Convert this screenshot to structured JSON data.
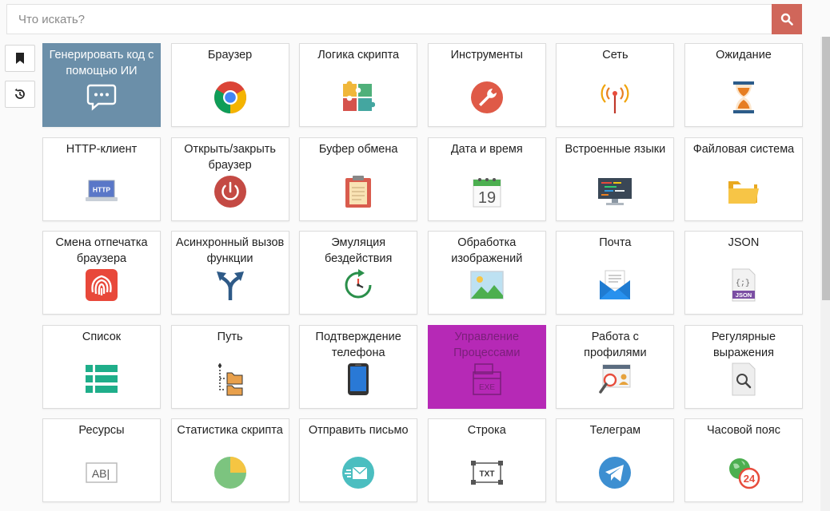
{
  "search": {
    "placeholder": "Что искать?"
  },
  "tiles": [
    {
      "label": "Генерировать код с помощью ИИ"
    },
    {
      "label": "Браузер"
    },
    {
      "label": "Логика скрипта"
    },
    {
      "label": "Инструменты"
    },
    {
      "label": "Сеть"
    },
    {
      "label": "Ожидание"
    },
    {
      "label": "HTTP-клиент",
      "icon_text": "HTTP"
    },
    {
      "label": "Открыть/закрыть браузер"
    },
    {
      "label": "Буфер обмена"
    },
    {
      "label": "Дата и время",
      "icon_text": "19"
    },
    {
      "label": "Встроенные языки"
    },
    {
      "label": "Файловая система"
    },
    {
      "label": "Смена отпечатка браузера"
    },
    {
      "label": "Асинхронный вызов функции"
    },
    {
      "label": "Эмуляция бездействия"
    },
    {
      "label": "Обработка изображений"
    },
    {
      "label": "Почта"
    },
    {
      "label": "JSON",
      "icon_text": "JSON",
      "icon_braces": "{;}"
    },
    {
      "label": "Список"
    },
    {
      "label": "Путь"
    },
    {
      "label": "Подтверждение телефона"
    },
    {
      "label": "Управление Процессами",
      "icon_text": "EXE"
    },
    {
      "label": "Работа с профилями"
    },
    {
      "label": "Регулярные выражения"
    },
    {
      "label": "Ресурсы",
      "icon_text": "AB|"
    },
    {
      "label": "Статистика скрипта"
    },
    {
      "label": "Отправить письмо"
    },
    {
      "label": "Строка",
      "icon_text": "TXT"
    },
    {
      "label": "Телеграм"
    },
    {
      "label": "Часовой пояс",
      "icon_text": "24"
    }
  ]
}
